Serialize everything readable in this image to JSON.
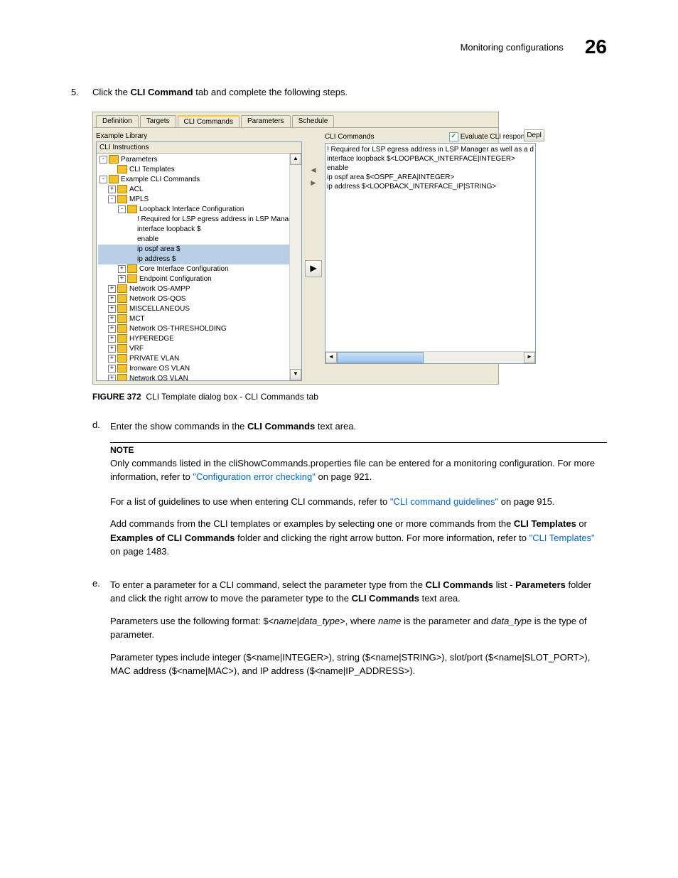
{
  "header": {
    "section": "Monitoring configurations",
    "chapter": "26"
  },
  "step5": {
    "num": "5.",
    "text_before": "Click the ",
    "bold1": "CLI Command",
    "text_after": " tab and complete the following steps."
  },
  "screenshot": {
    "tabs": [
      "Definition",
      "Targets",
      "CLI Commands",
      "Parameters",
      "Schedule"
    ],
    "selected_tab_index": 2,
    "left_title": "Example Library",
    "tree_header": "CLI Instructions",
    "tree": [
      {
        "ind": 0,
        "exp": "-",
        "icon": "folder",
        "label": "Parameters"
      },
      {
        "ind": 1,
        "exp": "",
        "icon": "folder",
        "label": "CLI Templates"
      },
      {
        "ind": 0,
        "exp": "-",
        "icon": "folder",
        "label": "Example CLI Commands"
      },
      {
        "ind": 1,
        "exp": "+",
        "icon": "folder",
        "label": "ACL"
      },
      {
        "ind": 1,
        "exp": "-",
        "icon": "folder",
        "label": "MPLS"
      },
      {
        "ind": 2,
        "exp": "-",
        "icon": "folder",
        "label": "Loopback Interface Configuration"
      },
      {
        "ind": 3,
        "exp": "",
        "icon": "",
        "label": "! Required for LSP egress address in LSP Manager as w"
      },
      {
        "ind": 3,
        "exp": "",
        "icon": "",
        "label": "interface loopback  $<LOOPBACK_INTERFACE|INTEGER>"
      },
      {
        "ind": 3,
        "exp": "",
        "icon": "",
        "label": "enable"
      },
      {
        "ind": 3,
        "exp": "",
        "icon": "",
        "label": "ip ospf area  $<OSPF_AREA|INTEGER>",
        "sel": true
      },
      {
        "ind": 3,
        "exp": "",
        "icon": "",
        "label": "ip address   $<LOOPBACK_INTERFACE_IP|STRING>",
        "sel": true
      },
      {
        "ind": 2,
        "exp": "+",
        "icon": "folder",
        "label": "Core Interface Configuration"
      },
      {
        "ind": 2,
        "exp": "+",
        "icon": "folder",
        "label": "Endpoint Configuration"
      },
      {
        "ind": 1,
        "exp": "+",
        "icon": "folder",
        "label": "Network OS-AMPP"
      },
      {
        "ind": 1,
        "exp": "+",
        "icon": "folder",
        "label": "Network OS-QOS"
      },
      {
        "ind": 1,
        "exp": "+",
        "icon": "folder",
        "label": "MISCELLANEOUS"
      },
      {
        "ind": 1,
        "exp": "+",
        "icon": "folder",
        "label": "MCT"
      },
      {
        "ind": 1,
        "exp": "+",
        "icon": "folder",
        "label": "Network OS-THRESHOLDING"
      },
      {
        "ind": 1,
        "exp": "+",
        "icon": "folder",
        "label": "HYPEREDGE"
      },
      {
        "ind": 1,
        "exp": "+",
        "icon": "folder",
        "label": "VRF"
      },
      {
        "ind": 1,
        "exp": "+",
        "icon": "folder",
        "label": "PRIVATE VLAN"
      },
      {
        "ind": 1,
        "exp": "+",
        "icon": "folder",
        "label": "Ironware OS VLAN"
      },
      {
        "ind": 1,
        "exp": "+",
        "icon": "folder",
        "label": "Network OS VLAN"
      }
    ],
    "right_header": "CLI Commands",
    "evaluate_label": "Evaluate CLI responses",
    "deploy_btn": "Depl",
    "right_text": [
      "! Required for LSP egress address in LSP Manager as well as a d",
      "interface loopback  $<LOOPBACK_INTERFACE|INTEGER>",
      "enable",
      "ip ospf area  $<OSPF_AREA|INTEGER>",
      "ip address   $<LOOPBACK_INTERFACE_IP|STRING>"
    ]
  },
  "figure": {
    "label": "FIGURE 372",
    "caption": "CLI Template dialog box - CLI Commands tab"
  },
  "step_d": {
    "letter": "d.",
    "t1": "Enter the show commands in the ",
    "b1": "CLI Commands",
    "t2": " text area."
  },
  "note": {
    "label": "NOTE",
    "t1": "Only commands listed in the cliShowCommands.properties file can be entered for a monitoring configuration. For more information, refer to ",
    "link1": "\"Configuration error checking\"",
    "t2": " on page 921."
  },
  "guide": {
    "t1": "For a list of guidelines to use when entering CLI commands, refer to ",
    "link1": "\"CLI command guidelines\"",
    "t2": " on page 915."
  },
  "addcmds": {
    "t1": "Add commands from the CLI templates or examples by selecting one or more commands from the ",
    "b1": "CLI Templates",
    "t2": " or ",
    "b2": "Examples of CLI Commands",
    "t3": " folder and clicking the right arrow button. For more information, refer to ",
    "link1": "\"CLI Templates\"",
    "t4": " on page 1483."
  },
  "step_e": {
    "letter": "e.",
    "t1": "To enter a parameter for a CLI command, select the parameter type from the ",
    "b1": "CLI Commands",
    "t2": " list - ",
    "b2": "Parameters",
    "t3": " folder and click the right arrow to move the parameter type to the ",
    "b3": "CLI Commands",
    "t4": " text area."
  },
  "param_p1": {
    "t1": "Parameters use the following format: $<",
    "i1": "name",
    "t2": "|",
    "i2": "data_type",
    "t3": ">, where ",
    "i3": "name",
    "t4": " is the parameter and ",
    "i4": "data_type",
    "t5": " is the type of parameter."
  },
  "param_p2": {
    "text": "Parameter types include integer ($<name|INTEGER>), string ($<name|STRING>), slot/port ($<name|SLOT_PORT>), MAC address ($<name|MAC>), and IP address ($<name|IP_ADDRESS>)."
  }
}
